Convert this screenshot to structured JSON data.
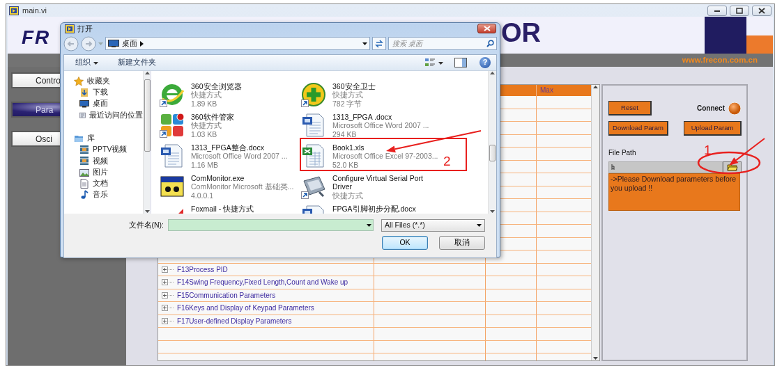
{
  "window": {
    "title": "main.vi"
  },
  "header": {
    "logo_left": "FR",
    "logo_right": "OR",
    "website": "www.frecon.com.cn"
  },
  "nav_buttons": [
    {
      "label": "Contro",
      "selected": false
    },
    {
      "label": "Para",
      "selected": true
    },
    {
      "label": "Osci",
      "selected": false
    }
  ],
  "table": {
    "columns": [
      {
        "label": "Max"
      }
    ],
    "rows": [
      {
        "name": "F13Process PID"
      },
      {
        "name": "F14Swing Frequency,Fixed Length,Count and Wake up"
      },
      {
        "name": "F15Communication Parameters"
      },
      {
        "name": "F16Keys and Display of Keypad Parameters"
      },
      {
        "name": "F17User-defined Display Parameters"
      }
    ]
  },
  "panel": {
    "reset": "Reset",
    "connect_label": "Connect",
    "download": "Download Param",
    "upload": "Upload Param",
    "file_path_label": "File Path",
    "message": "->Please Download parameters before you upload !!"
  },
  "dialog": {
    "title": "打开",
    "address": "桌面",
    "search": {
      "placeholder": "搜索 桌面"
    },
    "toolbar": [
      {
        "label": "组织",
        "kind": "menu"
      },
      {
        "label": "新建文件夹",
        "kind": "plain"
      }
    ],
    "help": "?",
    "nav": [
      {
        "label": "收藏夹",
        "kind": "star",
        "children": [
          {
            "label": "下载",
            "kind": "download"
          },
          {
            "label": "桌面",
            "kind": "desktop"
          },
          {
            "label": "最近访问的位置",
            "kind": "recent"
          }
        ]
      },
      {
        "label": "库",
        "kind": "library",
        "children": [
          {
            "label": "PPTV视频",
            "kind": "video"
          },
          {
            "label": "视频",
            "kind": "video"
          },
          {
            "label": "图片",
            "kind": "picture"
          },
          {
            "label": "文档",
            "kind": "document"
          },
          {
            "label": "音乐",
            "kind": "music"
          }
        ]
      }
    ],
    "files": [
      {
        "name": "360安全浏览器",
        "details": [
          "快捷方式",
          "1.89 KB"
        ],
        "kind": "browser",
        "shortcut": true
      },
      {
        "name": "360安全卫士",
        "details": [
          "快捷方式",
          "782 字节"
        ],
        "kind": "plus",
        "shortcut": true
      },
      {
        "name": "360软件管家",
        "details": [
          "快捷方式",
          "1.03 KB"
        ],
        "kind": "apps",
        "shortcut": true
      },
      {
        "name": "1313_FPGA .docx",
        "details": [
          "Microsoft Office Word 2007 ...",
          "294 KB"
        ],
        "kind": "word",
        "shortcut": false
      },
      {
        "name": "1313_FPGA整合.docx",
        "details": [
          "Microsoft Office Word 2007 ...",
          "1.16 MB"
        ],
        "kind": "word",
        "shortcut": false
      },
      {
        "name": "Book1.xls",
        "details": [
          "Microsoft Office Excel 97-2003...",
          "52.0 KB"
        ],
        "kind": "excel",
        "shortcut": false
      },
      {
        "name": "ComMonitor.exe",
        "details": [
          "ComMonitor Microsoft 基础类...",
          "4.0.0.1"
        ],
        "kind": "program",
        "shortcut": false
      },
      {
        "name": "Configure Virtual Serial Port Driver",
        "details": [
          "快捷方式"
        ],
        "kind": "port",
        "shortcut": true
      },
      {
        "name": "Foxmail - 快捷方式",
        "kind": "swoosh",
        "shortcut": false
      },
      {
        "name": "FPGA引脚初步分配.docx",
        "kind": "word",
        "shortcut": false
      }
    ],
    "filename_label": "文件名(N):",
    "filter": "All Files (*.*)",
    "buttons": [
      {
        "label": "OK",
        "selected": true
      },
      {
        "label": "取消",
        "selected": false
      }
    ]
  },
  "annotations": [
    {
      "label": "1"
    },
    {
      "label": "2"
    }
  ]
}
